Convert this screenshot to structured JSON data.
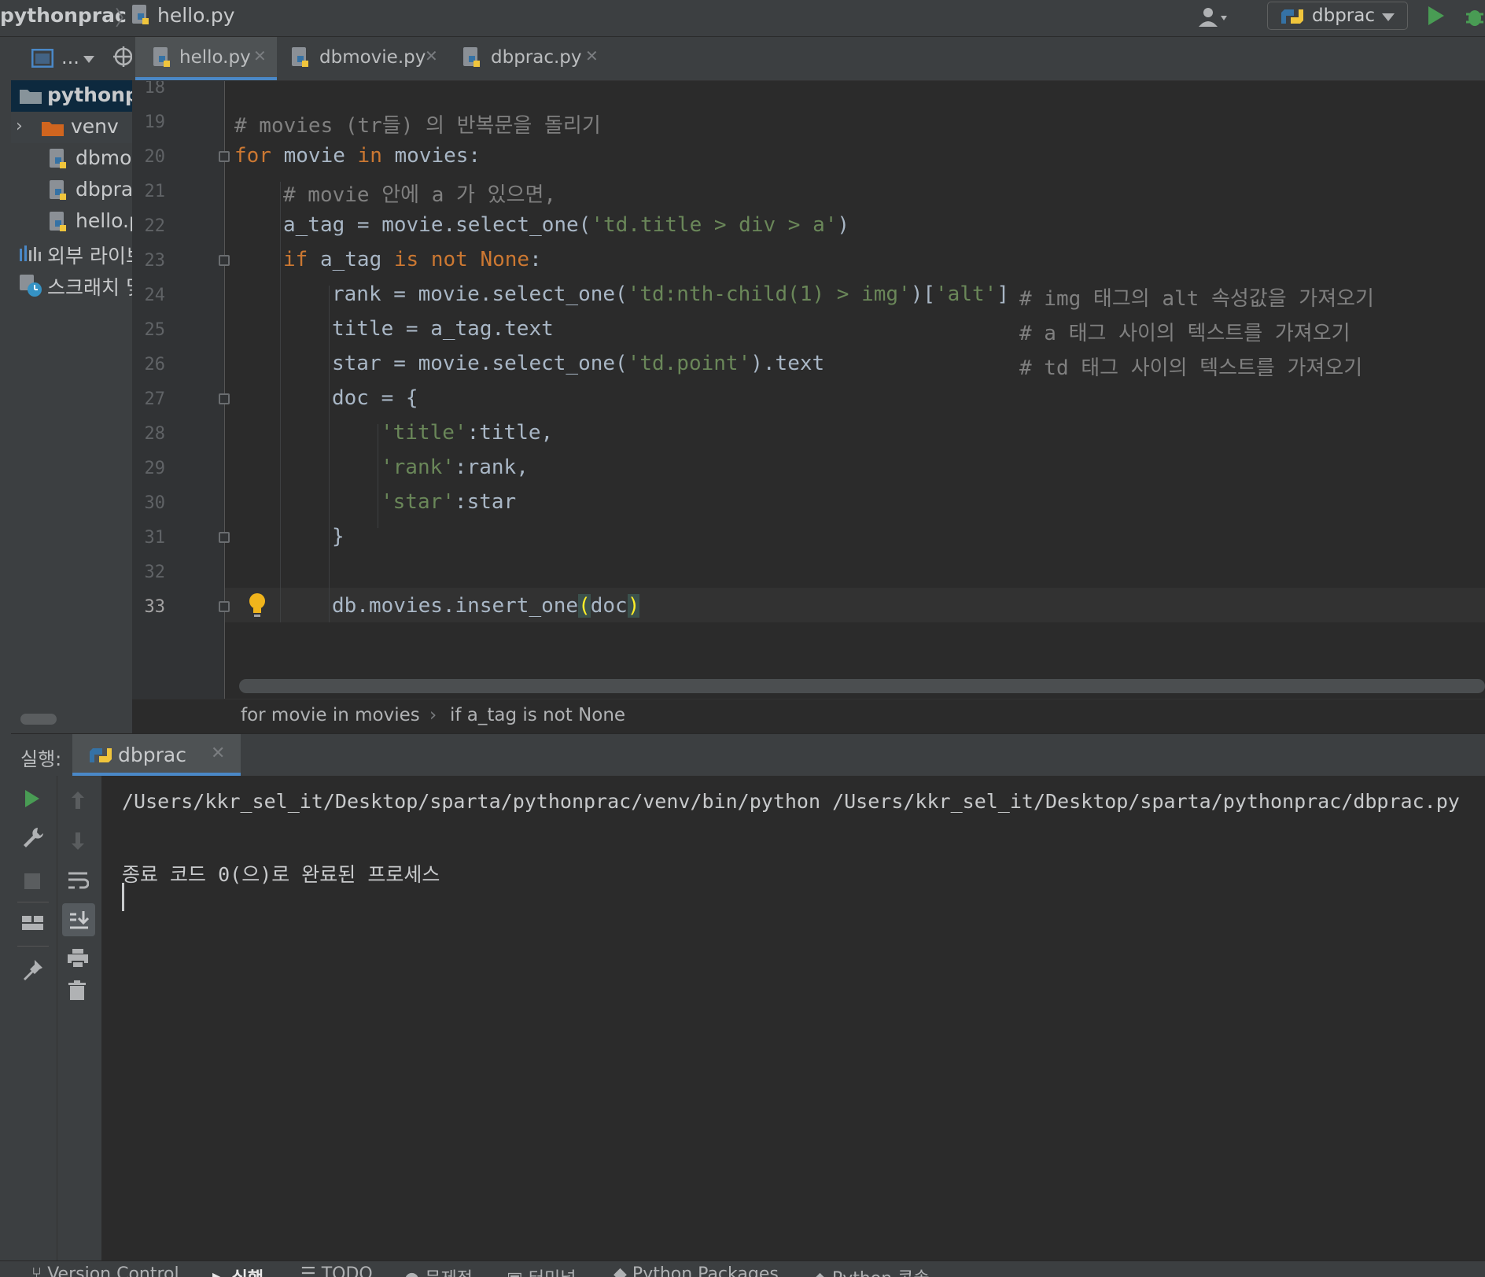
{
  "nav": {
    "project": "pythonprac",
    "separator": "〉",
    "file": "hello.py",
    "run_config": "dbprac"
  },
  "project_panel": {
    "toolbar_label": "...",
    "items": [
      {
        "label": "pythonp",
        "kind": "folder-open"
      },
      {
        "label": "venv",
        "kind": "folder"
      },
      {
        "label": "dbmo",
        "kind": "python-file"
      },
      {
        "label": "dbpra",
        "kind": "python-file"
      },
      {
        "label": "hello.p",
        "kind": "python-file"
      },
      {
        "label": "외부 라이브",
        "kind": "library"
      },
      {
        "label": "스크래치 및",
        "kind": "scratch"
      }
    ]
  },
  "editor_tabs": [
    {
      "label": "hello.py",
      "active": true
    },
    {
      "label": "dbmovie.py",
      "active": false
    },
    {
      "label": "dbprac.py",
      "active": false
    }
  ],
  "editor": {
    "line_numbers": [
      "18",
      "19",
      "20",
      "21",
      "22",
      "23",
      "24",
      "25",
      "26",
      "27",
      "28",
      "29",
      "30",
      "31",
      "32",
      "33"
    ],
    "current_line": "33",
    "lines": {
      "l19": "# movies (tr들) 의 반복문을 돌리기",
      "l20_kw": "for",
      "l20_a": " movie ",
      "l20_kw2": "in",
      "l20_b": " movies:",
      "l21": "# movie 안에 a 가 있으면,",
      "l22_a": "a_tag = movie.select_one(",
      "l22_s": "'td.title > div > a'",
      "l22_b": ")",
      "l23_kw": "if",
      "l23_a": " a_tag ",
      "l23_kw2": "is not None",
      "l23_b": ":",
      "l24_a": "rank = movie.select_one(",
      "l24_s1": "'td:nth-child(1) > img'",
      "l24_b": ")[",
      "l24_s2": "'alt'",
      "l24_c": "]",
      "l24_cm": "# img 태그의 alt 속성값을 가져오기",
      "l25_a": "title = a_tag.text",
      "l25_cm": "# a 태그 사이의 텍스트를 가져오기",
      "l26_a": "star = movie.select_one(",
      "l26_s": "'td.point'",
      "l26_b": ").text",
      "l26_cm": "# td 태그 사이의 텍스트를 가져오기",
      "l27": "doc = {",
      "l28_s": "'title'",
      "l28_b": ":title,",
      "l29_s": "'rank'",
      "l29_b": ":rank,",
      "l30_s": "'star'",
      "l30_b": ":star",
      "l31": "}",
      "l33_a": "db.movies.insert_one",
      "l33_p1": "(",
      "l33_b": "doc",
      "l33_p2": ")"
    }
  },
  "code_breadcrumbs": [
    "for movie in movies",
    "if a_tag is not None"
  ],
  "run_window": {
    "title": "실행:",
    "tab": "dbprac",
    "console": [
      "/Users/kkr_sel_it/Desktop/sparta/pythonprac/venv/bin/python /Users/kkr_sel_it/Desktop/sparta/pythonprac/dbprac.py",
      "",
      "종료 코드 0(으)로 완료된 프로세스"
    ]
  },
  "bottom_bar": [
    {
      "label": "Version Control",
      "active": false
    },
    {
      "label": "실행",
      "active": true
    },
    {
      "label": "TODO",
      "active": false
    },
    {
      "label": "문제점",
      "active": false
    },
    {
      "label": "터미널",
      "active": false
    },
    {
      "label": "Python Packages",
      "active": false
    },
    {
      "label": "Python 콘솔",
      "active": false
    }
  ],
  "colors": {
    "accent": "#4a88c7",
    "run_green": "#499c54",
    "keyword": "#cc7832",
    "string": "#6a8759",
    "comment": "#808080"
  }
}
